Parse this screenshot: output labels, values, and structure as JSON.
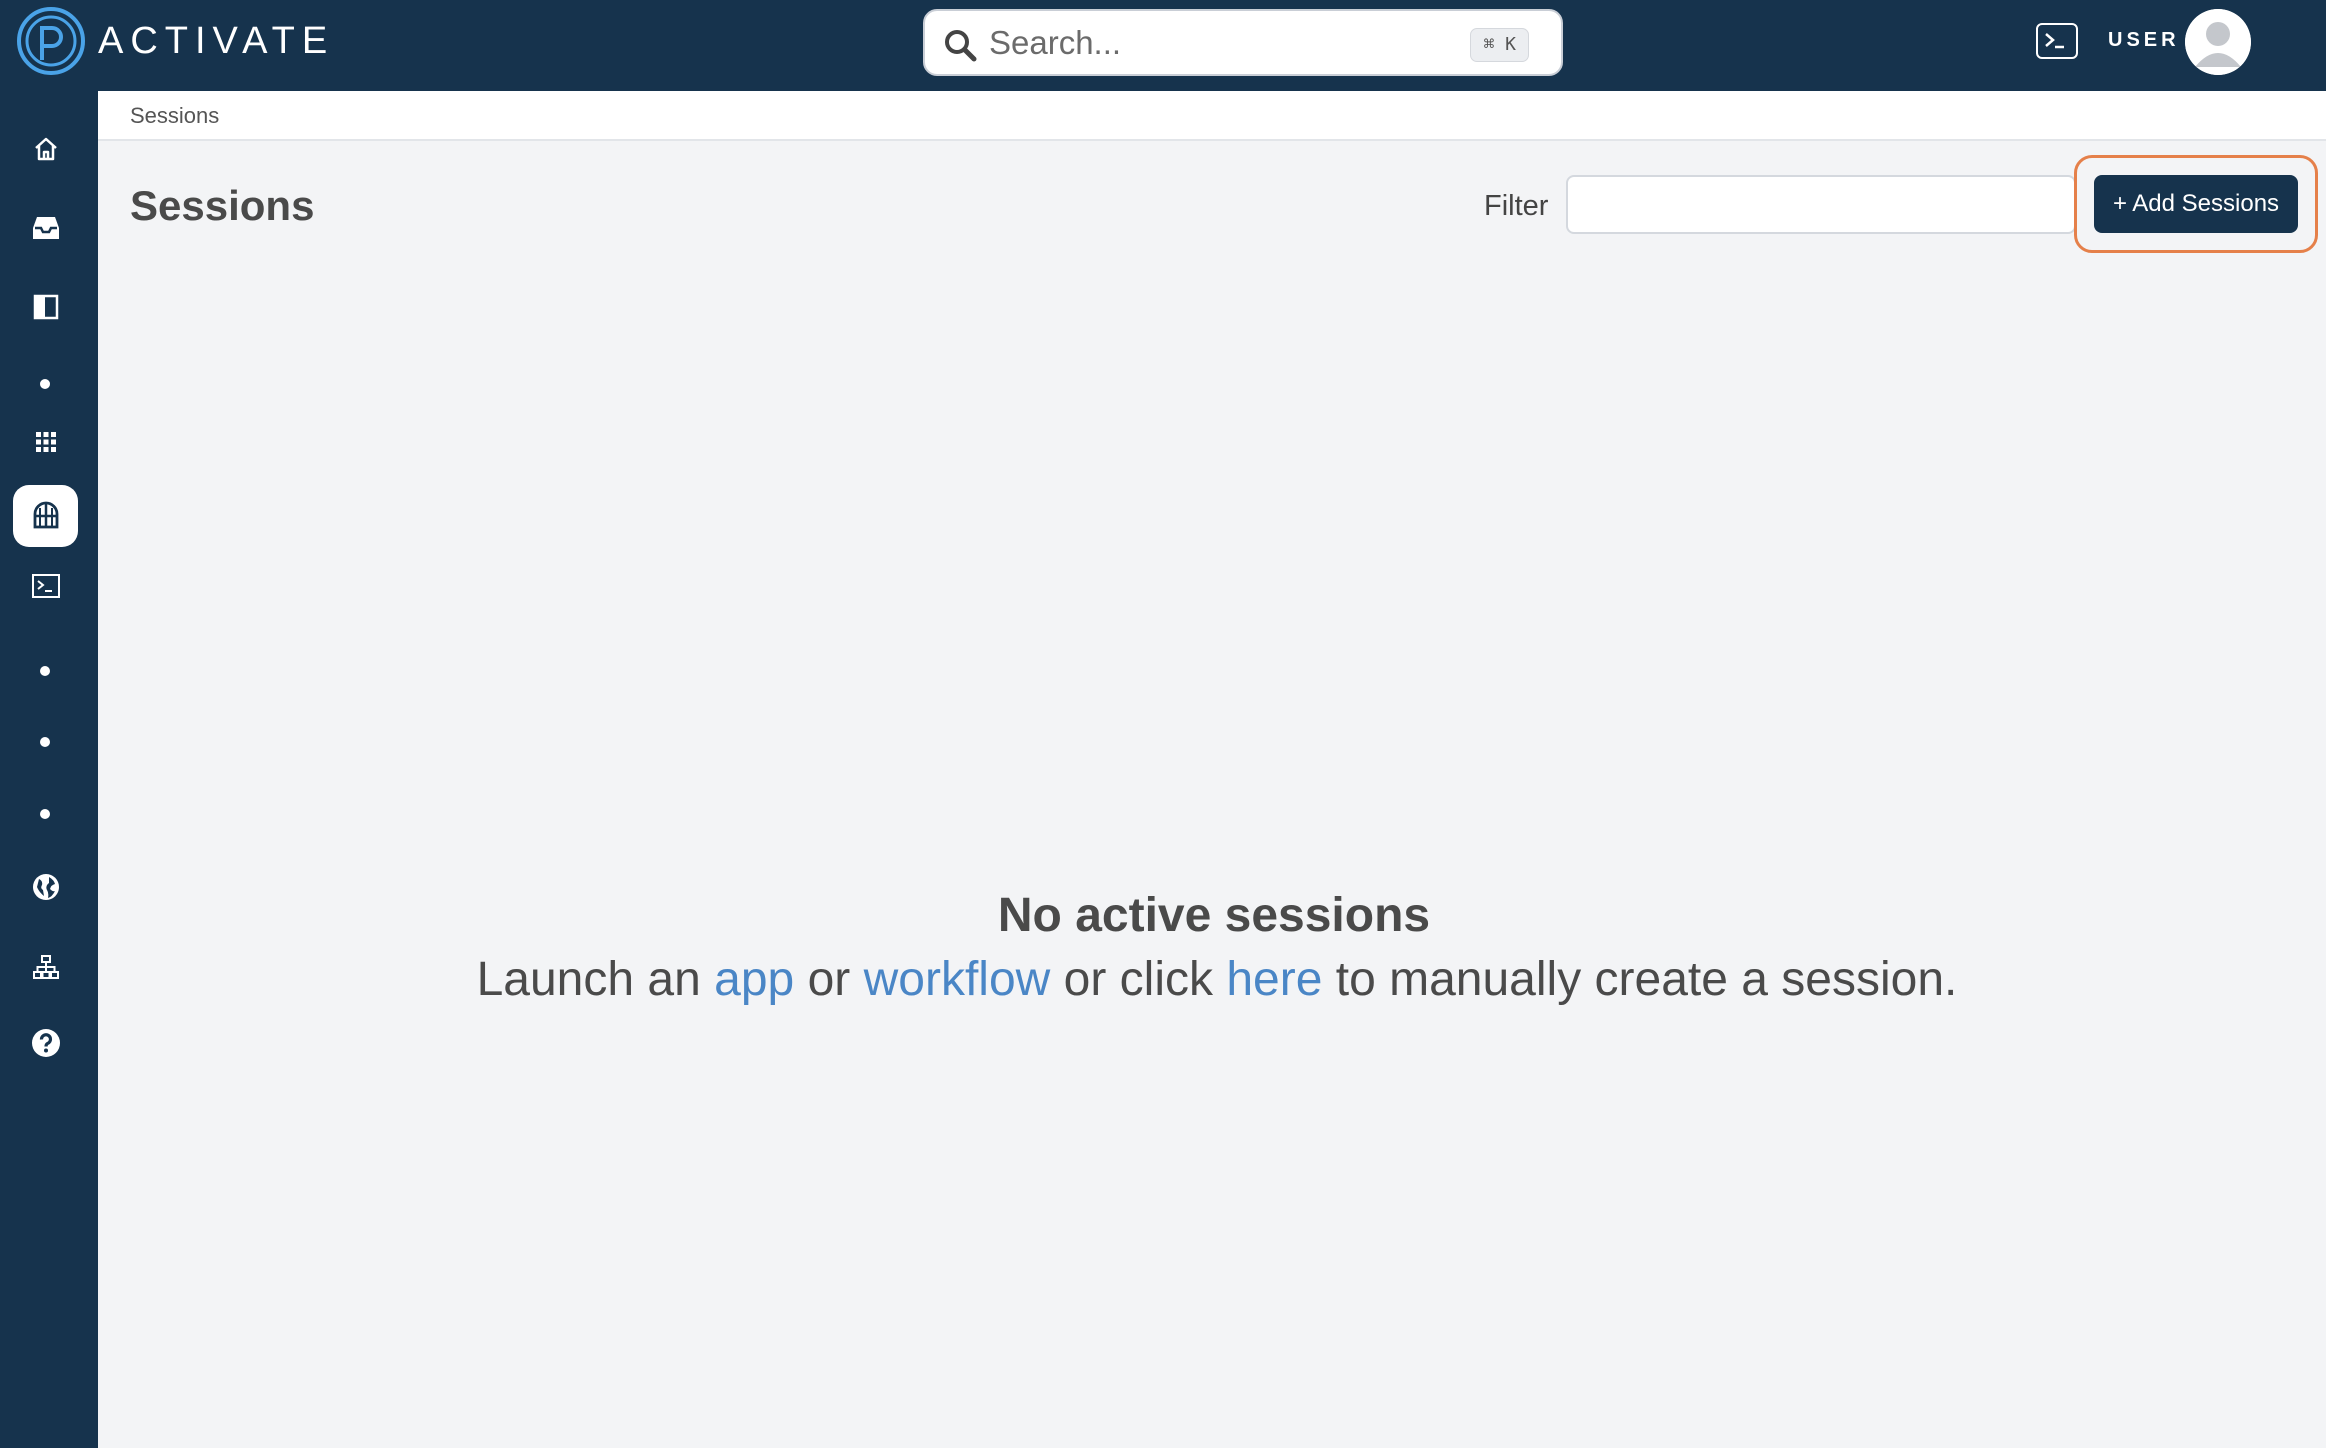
{
  "header": {
    "logo_text": "ACTIVATE",
    "search_placeholder": "Search...",
    "search_shortcut": "⌘ K",
    "user_label": "USER"
  },
  "breadcrumb": "Sessions",
  "page": {
    "title": "Sessions",
    "filter_label": "Filter",
    "filter_value": "",
    "add_button_label": "+ Add Sessions"
  },
  "empty_state": {
    "title": "No active sessions",
    "text_1": "Launch an ",
    "link_app": "app",
    "text_2": " or ",
    "link_workflow": "workflow",
    "text_3": " or click ",
    "link_here": "here",
    "text_4": " to manually create a session."
  },
  "sidebar": {
    "items": [
      {
        "icon": "home-icon"
      },
      {
        "icon": "inbox-icon"
      },
      {
        "icon": "sidebar-panel-icon"
      },
      {
        "icon": "dot-icon"
      },
      {
        "icon": "apps-grid-icon"
      },
      {
        "icon": "sessions-icon",
        "active": true
      },
      {
        "icon": "terminal-icon"
      },
      {
        "icon": "dot-icon"
      },
      {
        "icon": "dot-icon"
      },
      {
        "icon": "dot-icon"
      },
      {
        "icon": "globe-icon"
      },
      {
        "icon": "network-icon"
      },
      {
        "icon": "help-icon"
      }
    ]
  },
  "colors": {
    "nav_bg": "#16334d",
    "page_bg": "#f3f4f6",
    "link": "#4a86c6",
    "highlight": "#e5804a"
  }
}
